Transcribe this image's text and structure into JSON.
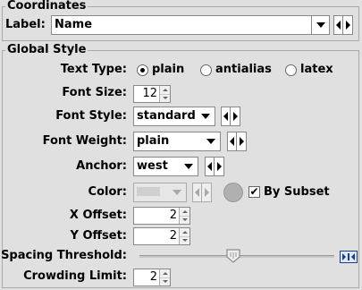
{
  "coordinates": {
    "title": "Coordinates",
    "label_text": "Label:",
    "label_value": "Name"
  },
  "global": {
    "title": "Global Style",
    "text_type": {
      "label": "Text Type:",
      "options": [
        "plain",
        "antialias",
        "latex"
      ],
      "selected": "plain"
    },
    "font_size": {
      "label": "Font Size:",
      "value": "12"
    },
    "font_style": {
      "label": "Font Style:",
      "value": "standard"
    },
    "font_weight": {
      "label": "Font Weight:",
      "value": "plain"
    },
    "anchor": {
      "label": "Anchor:",
      "value": "west"
    },
    "color": {
      "label": "Color:",
      "by_subset_label": "By Subset",
      "by_subset_checked": true,
      "enabled": false
    },
    "x_offset": {
      "label": "X Offset:",
      "value": "2"
    },
    "y_offset": {
      "label": "Y Offset:",
      "value": "2"
    },
    "spacing_threshold": {
      "label": "Spacing Threshold:",
      "level_fraction": 0.48
    },
    "crowding_limit": {
      "label": "Crowding Limit:",
      "value": "2"
    }
  },
  "colors": {
    "panel_bg": "#e0e0e0",
    "border": "#aaaaaa",
    "field_bg": "#ffffff",
    "disabled": "#a8a8a8",
    "accent": "#1a3a8a"
  },
  "icons": {
    "dropdown": "chevron-down-icon",
    "prev": "triangle-left-icon",
    "next": "triangle-right-icon",
    "slider_end": "slider-reset-icon"
  }
}
